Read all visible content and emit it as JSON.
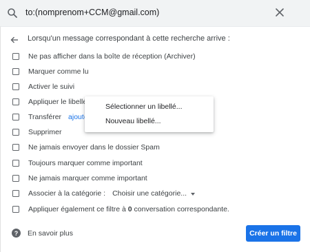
{
  "search": {
    "query": "to:(nomprenom+CCM@gmail.com)"
  },
  "filter": {
    "header": "Lorsqu'un message correspondant à cette recherche arrive :",
    "options": [
      "Ne pas afficher dans la boîte de réception (Archiver)",
      "Marquer comme lu",
      "Activer le suivi",
      "Appliquer le libellé :",
      "Transférer",
      "Supprimer",
      "Ne jamais envoyer dans le dossier Spam",
      "Toujours marquer comme important",
      "Ne jamais marquer comme important",
      "Associer à la catégorie :"
    ],
    "forward_link": "ajouter u",
    "category_select": "Choisir une catégorie...",
    "apply_also_prefix": "Appliquer également ce filtre à ",
    "apply_also_count": "0",
    "apply_also_suffix": " conversation correspondante."
  },
  "label_menu": {
    "items": [
      "Sélectionner un libellé...",
      "Nouveau libellé..."
    ]
  },
  "footer": {
    "help": "En savoir plus",
    "create_button": "Créer un filtre"
  },
  "colors": {
    "accent": "#1a73e8",
    "searchbar_bg": "#f1f3f4"
  }
}
